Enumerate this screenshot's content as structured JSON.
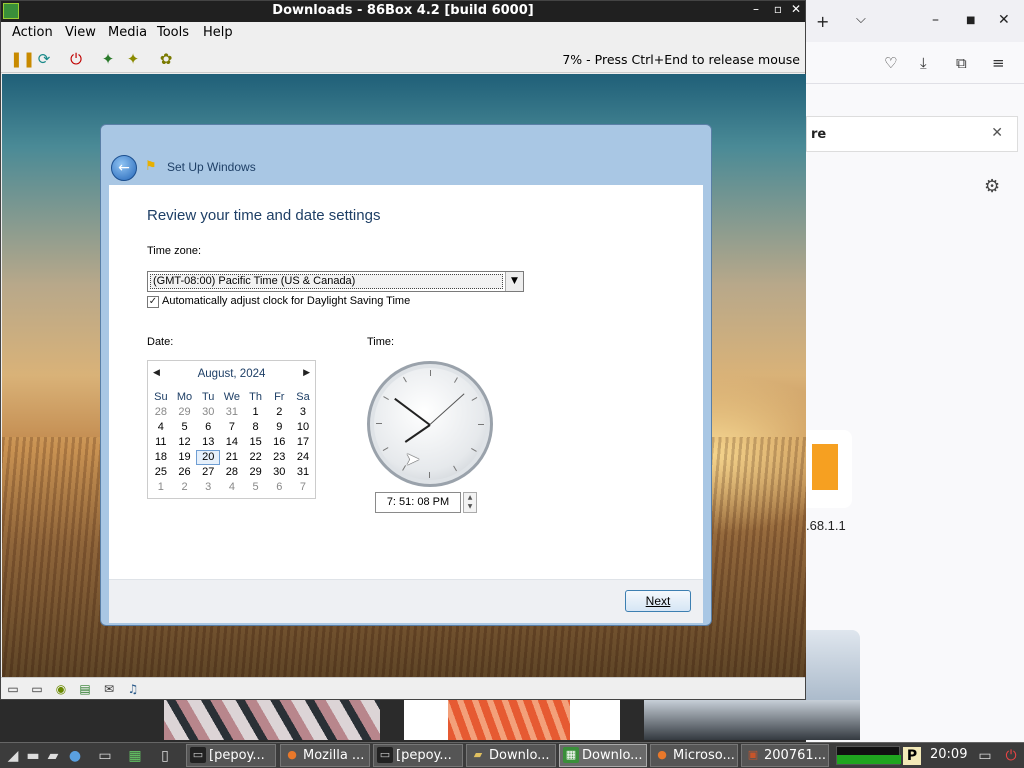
{
  "window": {
    "title": "Downloads - 86Box 4.2 [build 6000]",
    "minimize": "–",
    "maximize": "▫",
    "close": "✕"
  },
  "menu": [
    "Action",
    "View",
    "Media",
    "Tools",
    "Help"
  ],
  "toolbar": {
    "status": "7% - Press Ctrl+End to release mouse",
    "icons": [
      "pause-icon",
      "reset-icon",
      "power-icon",
      "ctrl-alt-del-icon",
      "ctrl-alt-esc-icon",
      "settings-icon"
    ]
  },
  "setup": {
    "window_title": "Set Up Windows",
    "heading": "Review your time and date settings",
    "timezone_label": "Time zone:",
    "timezone_value": "(GMT-08:00) Pacific Time (US & Canada)",
    "dst_label": "Automatically adjust clock for Daylight Saving Time",
    "dst_checked": true,
    "date_label": "Date:",
    "time_label": "Time:",
    "calendar": {
      "month": "August, 2024",
      "weekdays": [
        "Su",
        "Mo",
        "Tu",
        "We",
        "Th",
        "Fr",
        "Sa"
      ],
      "weeks": [
        [
          "28",
          "29",
          "30",
          "31",
          "1",
          "2",
          "3"
        ],
        [
          "4",
          "5",
          "6",
          "7",
          "8",
          "9",
          "10"
        ],
        [
          "11",
          "12",
          "13",
          "14",
          "15",
          "16",
          "17"
        ],
        [
          "18",
          "19",
          "20",
          "21",
          "22",
          "23",
          "24"
        ],
        [
          "25",
          "26",
          "27",
          "28",
          "29",
          "30",
          "31"
        ],
        [
          "1",
          "2",
          "3",
          "4",
          "5",
          "6",
          "7"
        ]
      ],
      "selected": "20"
    },
    "time_value": "7: 51: 08 PM",
    "next_label": "Next"
  },
  "browser": {
    "find_text": "re",
    "ip_text": ".68.1.1"
  },
  "taskbar": {
    "tasks": [
      "[pepoy...",
      "Mozilla ...",
      "[pepoy...",
      "Downlo...",
      "Downlo...",
      "Microso...",
      "200761..."
    ],
    "clock": "20:09"
  }
}
